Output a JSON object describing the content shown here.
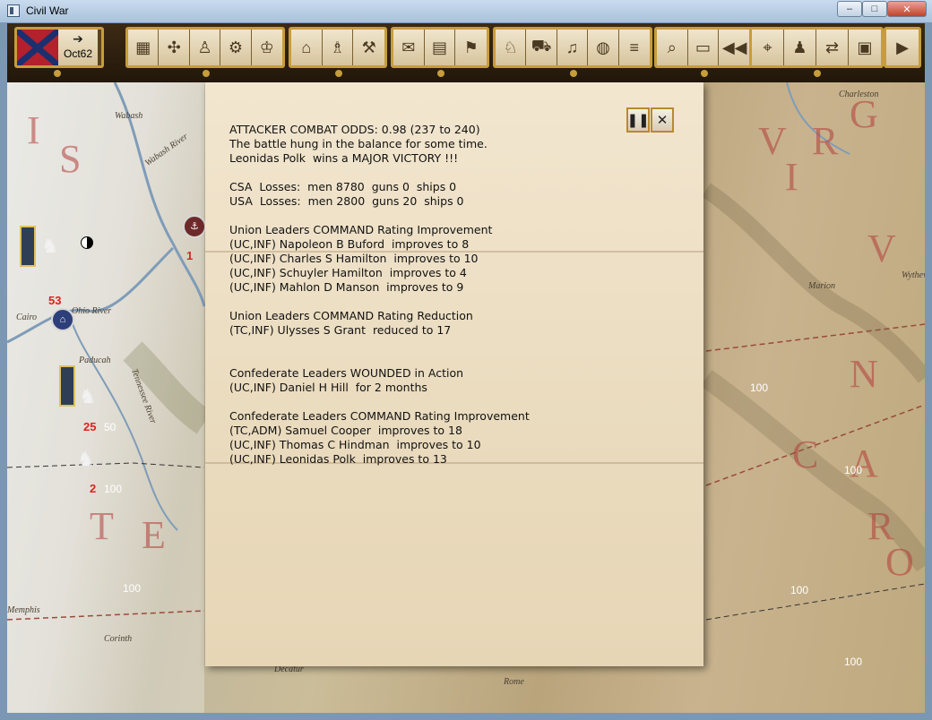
{
  "window": {
    "title": "Civil War",
    "minimize": "–",
    "maximize": "□",
    "close": "✕"
  },
  "toolbar": {
    "date": "Oct62",
    "icons": [
      "confederate-flag-icon",
      "end-turn-arrow-icon",
      "ledger-icon",
      "map-scroll-icon",
      "soldier-icon",
      "cannon-icon",
      "general-icon",
      "town-icon",
      "factory-icon",
      "officer-icon",
      "rifle-icon",
      "hammer-icon",
      "document-icon",
      "newspaper-icon",
      "flag-icon",
      "cavalry-icon",
      "carriage-icon",
      "musicians-icon",
      "globe-icon",
      "railroad-icon",
      "magnifier-icon",
      "usa-map-icon",
      "rewind-icon",
      "mouse-icon",
      "player-icon",
      "swap-icon",
      "save-disk-icon",
      "play-icon"
    ]
  },
  "report": {
    "pause": "❚❚",
    "close": "✕",
    "lines": [
      "ATTACKER COMBAT ODDS: 0.98 (237 to 240)",
      "The battle hung in the balance for some time.",
      "Leonidas Polk  wins a MAJOR VICTORY !!!",
      "",
      "CSA  Losses:  men 8780  guns 0  ships 0",
      "USA  Losses:  men 2800  guns 20  ships 0",
      "",
      "Union Leaders COMMAND Rating Improvement",
      "(UC,INF) Napoleon B Buford  improves to 8",
      "(UC,INF) Charles S Hamilton  improves to 10",
      "(UC,INF) Schuyler Hamilton  improves to 4",
      "(UC,INF) Mahlon D Manson  improves to 9",
      "",
      "Union Leaders COMMAND Rating Reduction",
      "(TC,INF) Ulysses S Grant  reduced to 17",
      "",
      "",
      "Confederate Leaders WOUNDED in Action",
      "(UC,INF) Daniel H Hill  for 2 months",
      "",
      "Confederate Leaders COMMAND Rating Improvement",
      "(TC,ADM) Samuel Cooper  improves to 18",
      "(UC,INF) Thomas C Hindman  improves to 10",
      "(UC,INF) Leonidas Polk  improves to 13"
    ]
  },
  "map": {
    "places": [
      "Wabash",
      "Wabash River",
      "Cairo",
      "Ohio River",
      "Paducah",
      "Tennessee River",
      "Corinth",
      "Memphis",
      "Decatur",
      "Rome",
      "Charleston",
      "Marion",
      "Wytheville"
    ],
    "state_letters": [
      "I",
      "S",
      "T",
      "E",
      "V",
      "I",
      "R",
      "G",
      "V",
      "N",
      "C",
      "A",
      "R",
      "O"
    ],
    "values": [
      "100",
      "100",
      "100",
      "100",
      "100",
      "100",
      "50",
      "100"
    ],
    "unit_numbers": [
      "53",
      "25",
      "2",
      "1"
    ]
  }
}
